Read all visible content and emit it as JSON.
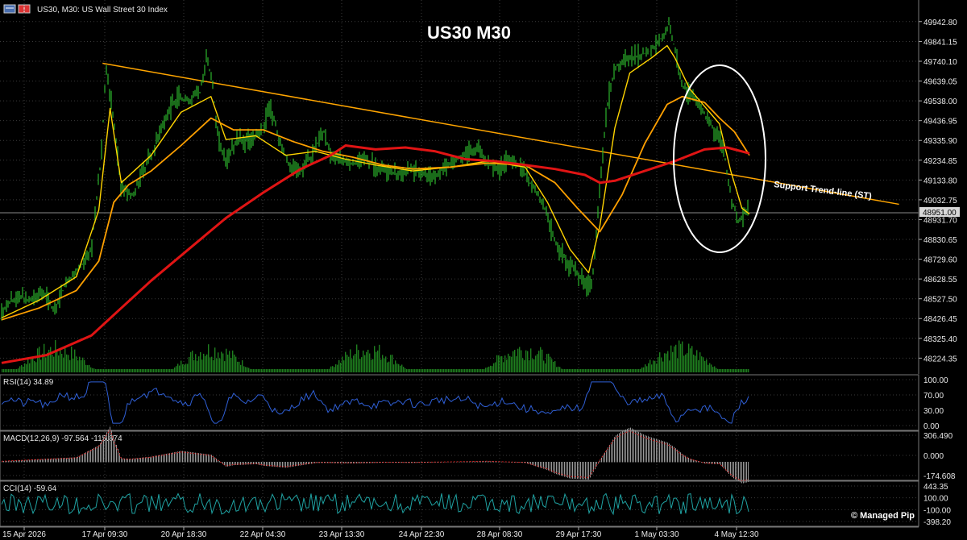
{
  "header": {
    "symbol_label": "US30, M30:  US Wall Street 30 Index",
    "icons": [
      "chart-window-icon",
      "trade-panel-icon"
    ]
  },
  "chart_title": "US30 M30",
  "watermark": "© Managed Pip",
  "colors": {
    "background": "#000000",
    "grid": "#3a3a3a",
    "price": "#2bb52b",
    "volume": "#1f7f1f",
    "ma_fast": "#ffd400",
    "ma_slow": "#ffa000",
    "ma_long": "#e01414",
    "trendline": "#ffa500",
    "rsi": "#2f5fd6",
    "macd_hist": "#9a9a9a",
    "macd_signal": "#c81e1e",
    "cci": "#1fa3a3",
    "price_tag_bg": "#d8d8d8"
  },
  "price_panel": {
    "y_ticks": [
      "49942.80",
      "49841.15",
      "49740.10",
      "49639.05",
      "49538.00",
      "49436.95",
      "49335.90",
      "49234.85",
      "49133.80",
      "49032.75",
      "48931.70",
      "48830.65",
      "48729.60",
      "48628.55",
      "48527.50",
      "48426.45",
      "48325.40",
      "48224.35"
    ],
    "current_price_tag": "48951.00",
    "annotation": "Support Trend-line (ST)"
  },
  "rsi_panel": {
    "label": "RSI(14) 34.89",
    "y_ticks": [
      "100.00",
      "70.00",
      "30.00",
      "0.00"
    ]
  },
  "macd_panel": {
    "label": "MACD(12,26,9) -97.564 -115.874",
    "y_ticks": [
      "306.490",
      "0.000",
      "-174.608"
    ]
  },
  "cci_panel": {
    "label": "CCI(14) -59.64",
    "y_ticks": [
      "443.35",
      "100.00",
      "-100.00",
      "-398.20"
    ]
  },
  "x_axis": {
    "ticks": [
      "15 Apr 2026",
      "17 Apr 09:30",
      "20 Apr 18:30",
      "22 Apr 04:30",
      "23 Apr 13:30",
      "24 Apr 22:30",
      "28 Apr 08:30",
      "29 Apr 17:30",
      "1 May 03:30",
      "4 May 12:30"
    ]
  },
  "chart_data": {
    "type": "line",
    "title": "US30 M30",
    "ylim": [
      48160,
      50020
    ],
    "x_index_range": [
      0,
      1
    ],
    "series": [
      {
        "name": "US30, M30",
        "points": [
          [
            0.0,
            48470
          ],
          [
            0.02,
            48540
          ],
          [
            0.04,
            48520
          ],
          [
            0.055,
            48560
          ],
          [
            0.07,
            48460
          ],
          [
            0.085,
            48600
          ],
          [
            0.105,
            48690
          ],
          [
            0.12,
            48780
          ],
          [
            0.133,
            49250
          ],
          [
            0.14,
            49720
          ],
          [
            0.15,
            49420
          ],
          [
            0.16,
            49100
          ],
          [
            0.175,
            49060
          ],
          [
            0.19,
            49180
          ],
          [
            0.205,
            49300
          ],
          [
            0.22,
            49470
          ],
          [
            0.235,
            49560
          ],
          [
            0.25,
            49540
          ],
          [
            0.265,
            49580
          ],
          [
            0.275,
            49760
          ],
          [
            0.282,
            49620
          ],
          [
            0.29,
            49330
          ],
          [
            0.3,
            49230
          ],
          [
            0.315,
            49340
          ],
          [
            0.33,
            49330
          ],
          [
            0.345,
            49380
          ],
          [
            0.36,
            49500
          ],
          [
            0.37,
            49360
          ],
          [
            0.385,
            49200
          ],
          [
            0.4,
            49180
          ],
          [
            0.415,
            49260
          ],
          [
            0.43,
            49390
          ],
          [
            0.44,
            49270
          ],
          [
            0.455,
            49230
          ],
          [
            0.47,
            49210
          ],
          [
            0.485,
            49250
          ],
          [
            0.5,
            49200
          ],
          [
            0.515,
            49190
          ],
          [
            0.53,
            49160
          ],
          [
            0.545,
            49200
          ],
          [
            0.56,
            49170
          ],
          [
            0.575,
            49150
          ],
          [
            0.59,
            49190
          ],
          [
            0.605,
            49230
          ],
          [
            0.62,
            49260
          ],
          [
            0.635,
            49300
          ],
          [
            0.65,
            49220
          ],
          [
            0.665,
            49190
          ],
          [
            0.68,
            49240
          ],
          [
            0.695,
            49200
          ],
          [
            0.71,
            49100
          ],
          [
            0.725,
            49010
          ],
          [
            0.74,
            48820
          ],
          [
            0.755,
            48720
          ],
          [
            0.77,
            48670
          ],
          [
            0.78,
            48590
          ],
          [
            0.79,
            48610
          ],
          [
            0.8,
            49100
          ],
          [
            0.81,
            49520
          ],
          [
            0.82,
            49700
          ],
          [
            0.835,
            49770
          ],
          [
            0.85,
            49760
          ],
          [
            0.87,
            49800
          ],
          [
            0.885,
            49870
          ],
          [
            0.893,
            49940
          ],
          [
            0.9,
            49800
          ],
          [
            0.91,
            49620
          ],
          [
            0.925,
            49550
          ],
          [
            0.94,
            49470
          ],
          [
            0.955,
            49380
          ],
          [
            0.965,
            49300
          ],
          [
            0.975,
            49050
          ],
          [
            0.985,
            48920
          ],
          [
            1.0,
            48990
          ]
        ]
      },
      {
        "name": "Fast MA",
        "points": [
          [
            0.0,
            48430
          ],
          [
            0.05,
            48520
          ],
          [
            0.1,
            48640
          ],
          [
            0.13,
            48980
          ],
          [
            0.145,
            49500
          ],
          [
            0.16,
            49120
          ],
          [
            0.2,
            49260
          ],
          [
            0.24,
            49480
          ],
          [
            0.28,
            49560
          ],
          [
            0.3,
            49340
          ],
          [
            0.34,
            49360
          ],
          [
            0.38,
            49260
          ],
          [
            0.42,
            49280
          ],
          [
            0.46,
            49240
          ],
          [
            0.5,
            49210
          ],
          [
            0.55,
            49180
          ],
          [
            0.6,
            49200
          ],
          [
            0.65,
            49230
          ],
          [
            0.7,
            49200
          ],
          [
            0.73,
            49020
          ],
          [
            0.76,
            48780
          ],
          [
            0.785,
            48660
          ],
          [
            0.8,
            48900
          ],
          [
            0.82,
            49400
          ],
          [
            0.84,
            49680
          ],
          [
            0.87,
            49760
          ],
          [
            0.89,
            49820
          ],
          [
            0.9,
            49760
          ],
          [
            0.92,
            49600
          ],
          [
            0.94,
            49510
          ],
          [
            0.96,
            49420
          ],
          [
            0.975,
            49180
          ],
          [
            0.99,
            48990
          ],
          [
            1.0,
            48960
          ]
        ]
      },
      {
        "name": "Slow MA",
        "points": [
          [
            0.0,
            48420
          ],
          [
            0.05,
            48480
          ],
          [
            0.1,
            48570
          ],
          [
            0.13,
            48720
          ],
          [
            0.15,
            49020
          ],
          [
            0.17,
            49110
          ],
          [
            0.2,
            49180
          ],
          [
            0.24,
            49310
          ],
          [
            0.28,
            49450
          ],
          [
            0.31,
            49390
          ],
          [
            0.35,
            49390
          ],
          [
            0.39,
            49330
          ],
          [
            0.43,
            49280
          ],
          [
            0.47,
            49250
          ],
          [
            0.51,
            49210
          ],
          [
            0.55,
            49190
          ],
          [
            0.6,
            49200
          ],
          [
            0.65,
            49220
          ],
          [
            0.7,
            49210
          ],
          [
            0.74,
            49120
          ],
          [
            0.77,
            48990
          ],
          [
            0.8,
            48870
          ],
          [
            0.83,
            49060
          ],
          [
            0.86,
            49320
          ],
          [
            0.89,
            49520
          ],
          [
            0.91,
            49560
          ],
          [
            0.94,
            49530
          ],
          [
            0.96,
            49450
          ],
          [
            0.98,
            49380
          ],
          [
            1.0,
            49260
          ]
        ]
      },
      {
        "name": "Long MA",
        "points": [
          [
            0.0,
            48200
          ],
          [
            0.06,
            48240
          ],
          [
            0.12,
            48340
          ],
          [
            0.16,
            48480
          ],
          [
            0.2,
            48620
          ],
          [
            0.25,
            48780
          ],
          [
            0.3,
            48940
          ],
          [
            0.35,
            49070
          ],
          [
            0.4,
            49190
          ],
          [
            0.44,
            49260
          ],
          [
            0.46,
            49310
          ],
          [
            0.5,
            49290
          ],
          [
            0.54,
            49300
          ],
          [
            0.58,
            49280
          ],
          [
            0.62,
            49240
          ],
          [
            0.66,
            49230
          ],
          [
            0.7,
            49210
          ],
          [
            0.74,
            49190
          ],
          [
            0.78,
            49160
          ],
          [
            0.8,
            49120
          ],
          [
            0.82,
            49130
          ],
          [
            0.86,
            49180
          ],
          [
            0.9,
            49230
          ],
          [
            0.94,
            49290
          ],
          [
            0.97,
            49300
          ],
          [
            1.0,
            49270
          ]
        ]
      }
    ],
    "trendline": {
      "label": "Support Trend-line (ST)",
      "start": [
        0.135,
        49730
      ],
      "end": [
        1.2,
        49010
      ]
    }
  }
}
